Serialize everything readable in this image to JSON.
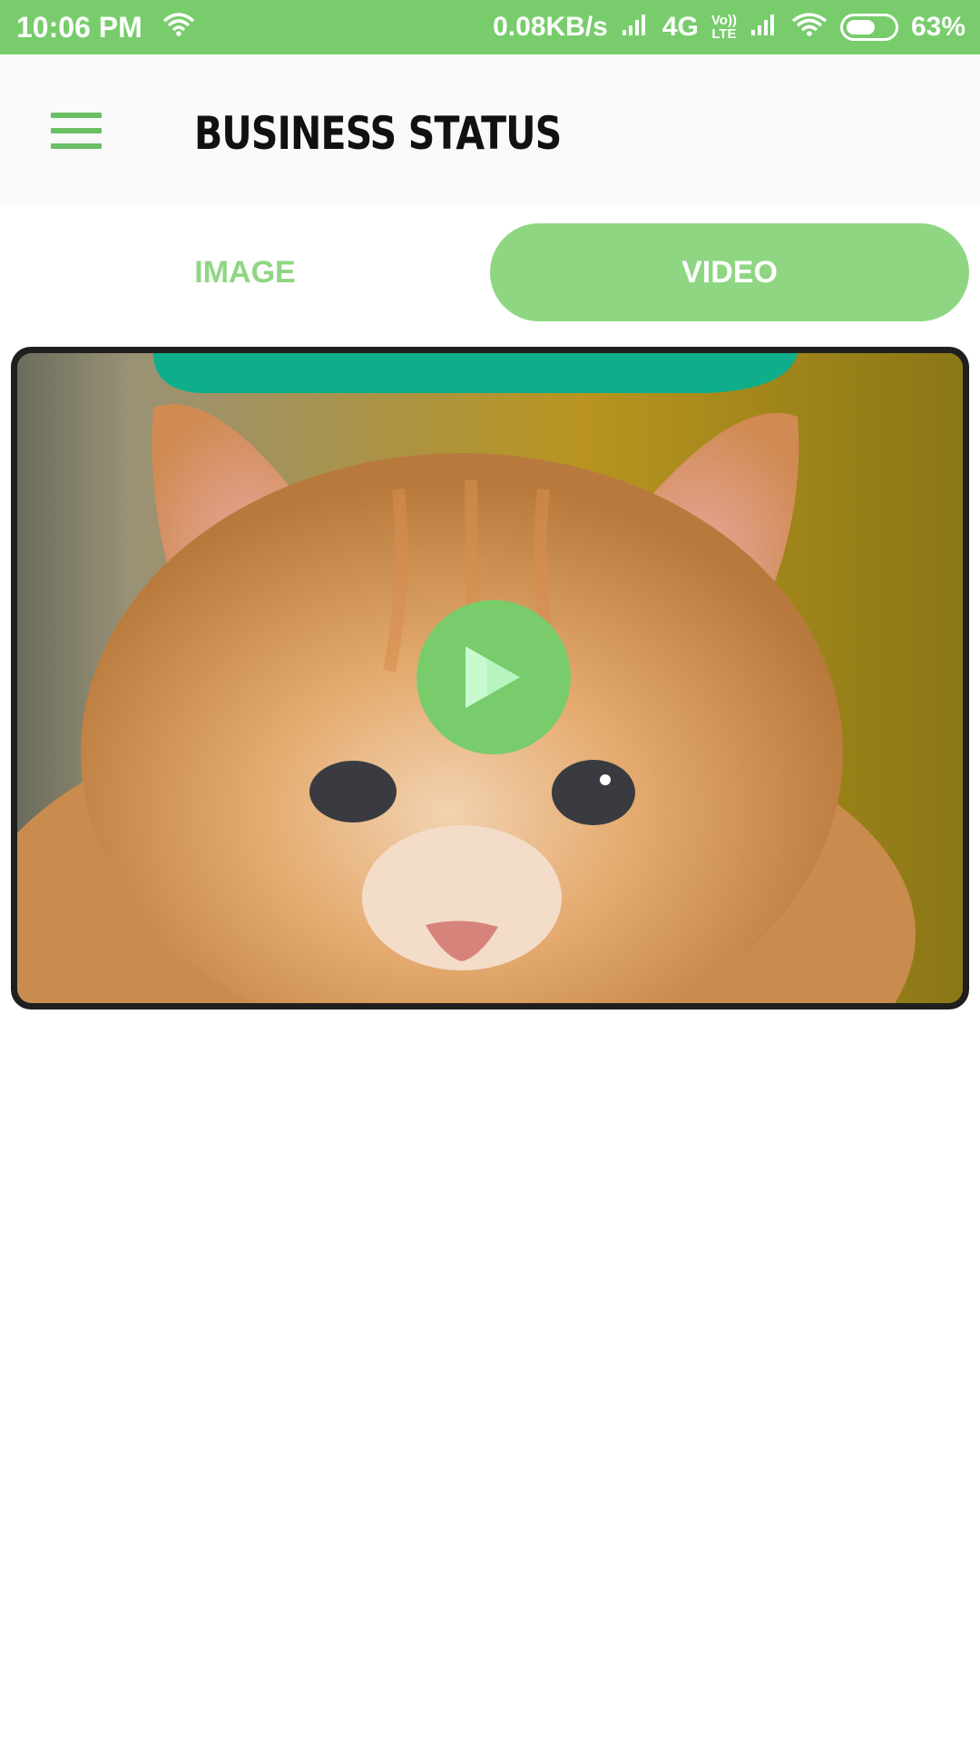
{
  "status_bar": {
    "time": "10:06 PM",
    "speed": "0.08KB/s",
    "network": "4G",
    "volte_top": "Vo))",
    "volte_bottom": "LTE",
    "battery": "63%",
    "battery_level": 0.63
  },
  "app_bar": {
    "title": "BUSINESS STATUS",
    "menu_icon": "hamburger-menu-icon"
  },
  "tabs": [
    {
      "label": "IMAGE",
      "selected": false
    },
    {
      "label": "VIDEO",
      "selected": true
    }
  ],
  "video_card": {
    "play_icon": "play-icon"
  },
  "colors": {
    "accent": "#78cc6c",
    "tab_accent": "#8fd682",
    "title": "#111111"
  }
}
